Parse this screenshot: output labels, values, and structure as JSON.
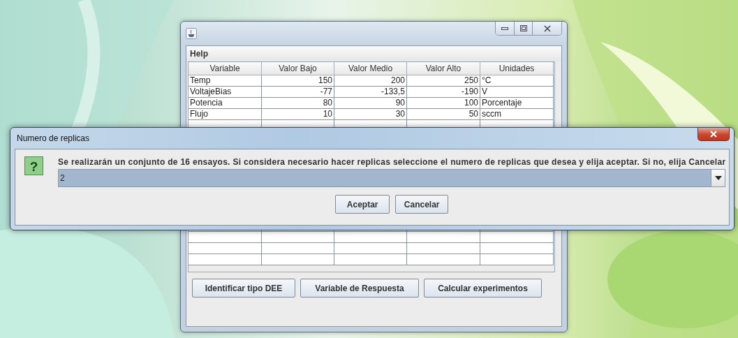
{
  "main_window": {
    "menu": [
      "Help"
    ],
    "table": {
      "columns": [
        "Variable",
        "Valor Bajo",
        "Valor Medio",
        "Valor Alto",
        "Unidades"
      ],
      "rows": [
        [
          "Temp",
          "150",
          "200",
          "250",
          "°C"
        ],
        [
          "VoltajeBias",
          "-77",
          "-133,5",
          "-190",
          "V"
        ],
        [
          "Potencia",
          "80",
          "90",
          "100",
          "Porcentaje"
        ],
        [
          "Flujo",
          "10",
          "30",
          "50",
          "sccm"
        ]
      ]
    },
    "buttons": [
      "Identificar tipo DEE",
      "Variable de Respuesta",
      "Calcular experimentos"
    ]
  },
  "dialog": {
    "title": "Numero de replicas",
    "icon_glyph": "?",
    "message": "Se realizarán un conjunto de 16 ensayos. Si considera necesario hacer replicas  seleccione el numero de replicas que desea y elija aceptar. Si no, elija Cancelar",
    "combo": {
      "value": "2"
    },
    "buttons": [
      "Aceptar",
      "Cancelar"
    ]
  }
}
